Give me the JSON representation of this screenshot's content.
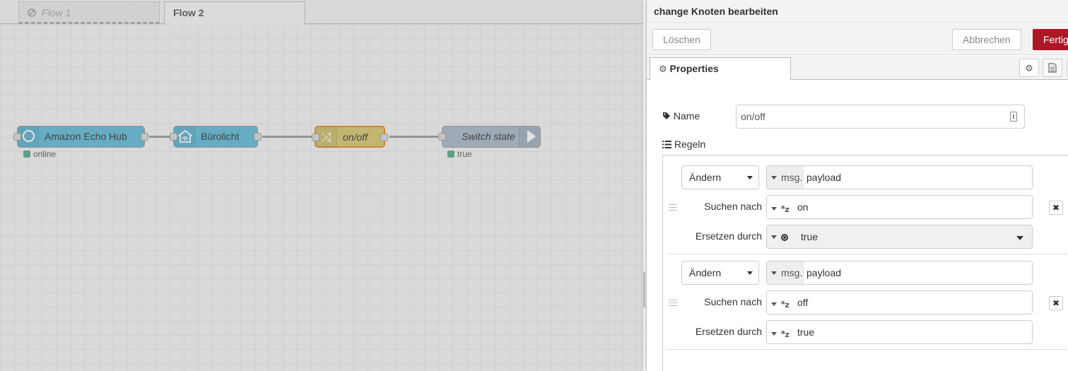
{
  "workspace": {
    "tabs": [
      {
        "label": "Flow 1",
        "disabled": true
      },
      {
        "label": "Flow 2",
        "active": true
      }
    ],
    "nodes": [
      {
        "label": "Amazon Echo Hub",
        "icon": "circle-icon",
        "status": "online"
      },
      {
        "label": "Bürolicht",
        "icon": "smart-home-icon"
      },
      {
        "label": "on/off",
        "icon": "shuffle-icon",
        "selected": true
      },
      {
        "label": "Switch state",
        "icon": "arrow-right-icon",
        "status": "true"
      }
    ]
  },
  "tray": {
    "title": "change Knoten bearbeiten",
    "buttons": {
      "delete": "Löschen",
      "cancel": "Abbrechen",
      "done": "Fertig"
    },
    "tab_properties": "Properties",
    "name_label": "Name",
    "name_value": "on/off",
    "rules_label": "Regeln",
    "rules": [
      {
        "action": "Ändern",
        "target_type": "msg.",
        "target_value": "payload",
        "search_label": "Suchen nach",
        "search_type": "az",
        "search_value": "on",
        "replace_label": "Ersetzen durch",
        "replace_type": "boolean",
        "replace_value": "true"
      },
      {
        "action": "Ändern",
        "target_type": "msg.",
        "target_value": "payload",
        "search_label": "Suchen nach",
        "search_type": "az",
        "search_value": "off",
        "replace_label": "Ersetzen durch",
        "replace_type": "az",
        "replace_value": "true"
      }
    ],
    "remove_glyph": "✖"
  },
  "colors": {
    "done_button": "#ad1625",
    "input_node": "#5fb9d6",
    "change_node": "#d6c66e",
    "selected_border": "#e08a1e",
    "status_green": "#5a8"
  }
}
